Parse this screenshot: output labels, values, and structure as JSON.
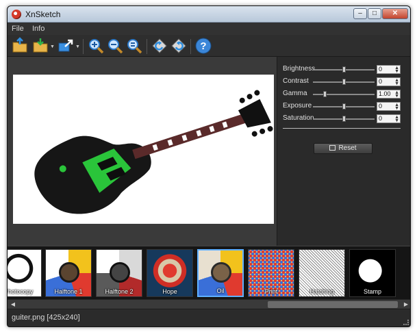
{
  "window": {
    "title": "XnSketch"
  },
  "menu": {
    "file": "File",
    "info": "Info"
  },
  "toolbar": {
    "buttons": [
      {
        "name": "open-folder-icon"
      },
      {
        "name": "save-folder-icon"
      },
      {
        "name": "export-icon"
      },
      {
        "name": "zoom-in-icon"
      },
      {
        "name": "zoom-out-icon"
      },
      {
        "name": "zoom-fit-icon"
      },
      {
        "name": "rotate-left-icon"
      },
      {
        "name": "rotate-right-icon"
      },
      {
        "name": "help-icon"
      }
    ]
  },
  "adjustments": [
    {
      "label": "Brightness",
      "value": "0",
      "level": 0.5
    },
    {
      "label": "Contrast",
      "value": "0",
      "level": 0.5
    },
    {
      "label": "Gamma",
      "value": "1.00",
      "level": 0.18
    },
    {
      "label": "Exposure",
      "value": "0",
      "level": 0.5
    },
    {
      "label": "Saturation",
      "value": "0",
      "level": 0.5
    }
  ],
  "reset_label": "Reset",
  "filters": [
    {
      "label": "Photocopy",
      "selected": false
    },
    {
      "label": "Halftone 1",
      "selected": false
    },
    {
      "label": "Halftone 2",
      "selected": false
    },
    {
      "label": "Hope",
      "selected": false
    },
    {
      "label": "Oil",
      "selected": true
    },
    {
      "label": "Print",
      "selected": false
    },
    {
      "label": "Hatching",
      "selected": false
    },
    {
      "label": "Stamp",
      "selected": false
    }
  ],
  "status": {
    "file_info": "guiter.png [425x240]"
  },
  "colors": {
    "accent": "#5fb0ff",
    "canvas_bg": "#3a3a3a",
    "panel_bg": "#2a2a2a"
  }
}
